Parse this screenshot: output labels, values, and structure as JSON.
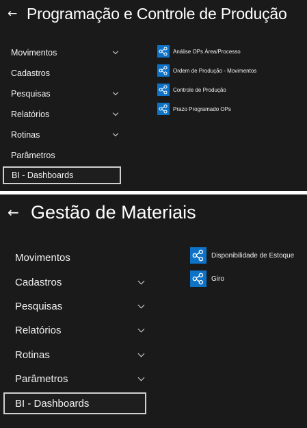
{
  "panels": [
    {
      "header": {
        "title": "Programação e Controle de Produção",
        "back_icon": "←"
      },
      "menu": [
        {
          "label": "Movimentos",
          "expandable": true
        },
        {
          "label": "Cadastros",
          "expandable": false
        },
        {
          "label": "Pesquisas",
          "expandable": true
        },
        {
          "label": "Relatórios",
          "expandable": true
        },
        {
          "label": "Rotinas",
          "expandable": true
        },
        {
          "label": "Parâmetros",
          "expandable": false
        },
        {
          "label": "BI - Dashboards",
          "expandable": false,
          "selected": true
        }
      ],
      "dashboards": [
        {
          "label": "Análise OPs Área/Processo",
          "icon": "dashboard-share-icon"
        },
        {
          "label": "Ordem de Produção - Movimentos",
          "icon": "dashboard-share-icon"
        },
        {
          "label": "Controle de Produção",
          "icon": "dashboard-share-icon"
        },
        {
          "label": "Prazo Programado OPs",
          "icon": "dashboard-share-icon"
        }
      ]
    },
    {
      "header": {
        "title": "Gestão de Materiais",
        "back_icon": "←"
      },
      "menu": [
        {
          "label": "Movimentos",
          "expandable": false
        },
        {
          "label": "Cadastros",
          "expandable": true
        },
        {
          "label": "Pesquisas",
          "expandable": true
        },
        {
          "label": "Relatórios",
          "expandable": true
        },
        {
          "label": "Rotinas",
          "expandable": true
        },
        {
          "label": "Parâmetros",
          "expandable": true
        },
        {
          "label": "BI - Dashboards",
          "expandable": false,
          "selected": true
        }
      ],
      "dashboards": [
        {
          "label": "Disponibilidade de Estoque",
          "icon": "dashboard-share-icon"
        },
        {
          "label": "Giro",
          "icon": "dashboard-share-icon"
        }
      ]
    }
  ],
  "colors": {
    "panel_background": "#1a1a1a",
    "tile_accent": "#0e72c6",
    "selected_border": "#d0d0d0",
    "text": "#ffffff"
  }
}
